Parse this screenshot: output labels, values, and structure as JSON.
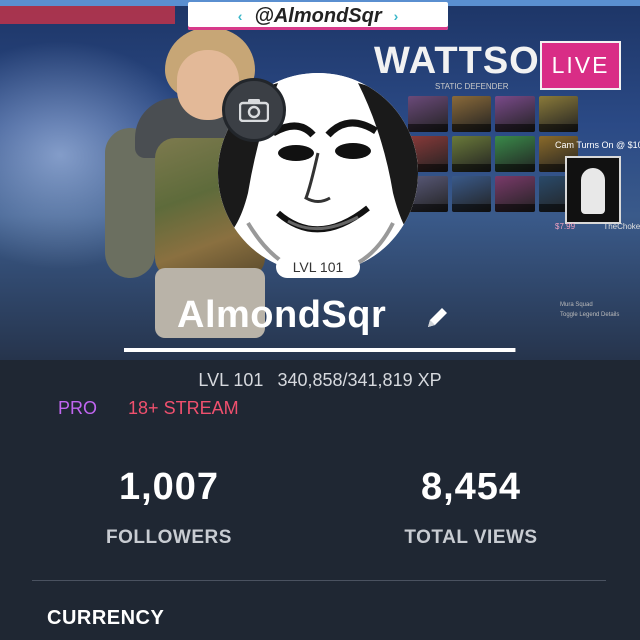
{
  "banner": {
    "handle": "@AlmondSqr",
    "live_label": "LIVE",
    "game": {
      "legend_title": "WATTSON",
      "legend_subtitle": "STATIC DEFENDER",
      "cam_prompt": "Cam Turns On @ $10",
      "cam_amount": "$7.99",
      "cam_name": "TheChoke",
      "footer_lines": [
        "Mura Squad",
        "Toggle Legend Details"
      ],
      "tile_colors": [
        "#6b4a7a",
        "#8a6a3a",
        "#7a4a8a",
        "#8a7a3a",
        "#8a3a3a",
        "#6a7a3a",
        "#3a8a4a",
        "#8a6a2a",
        "#5a5a7a",
        "#3a5a8a",
        "#7a3a6a",
        "#2a4a6a"
      ]
    }
  },
  "profile": {
    "avatar_level": "LVL 101",
    "username": "AlmondSqr",
    "xp_progress": 0.9972,
    "level": "LVL 101",
    "xp_text": "340,858/341,819 XP",
    "tag_pro": "PRO",
    "tag_mature": "18+ STREAM"
  },
  "stats": {
    "followers_value": "1,007",
    "followers_label": "FOLLOWERS",
    "views_value": "8,454",
    "views_label": "TOTAL VIEWS"
  },
  "sections": {
    "currency_title": "CURRENCY"
  },
  "icons": {
    "camera": "camera-icon",
    "edit": "pencil-icon",
    "chevron_left": "chevron-left-icon",
    "chevron_right": "chevron-right-icon"
  },
  "colors": {
    "background": "#1f2733",
    "live": "#d92d86",
    "pro": "#c065f0",
    "mature": "#f0506e"
  }
}
